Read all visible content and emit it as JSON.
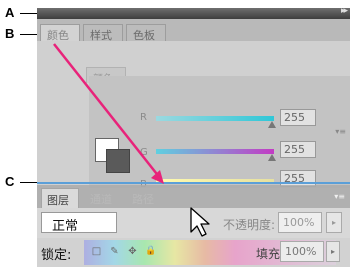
{
  "callouts": {
    "a": "A",
    "b": "B",
    "c": "C"
  },
  "panel": {
    "expand_glyph": "▸▸",
    "tabs": [
      "颜色",
      "样式",
      "色板"
    ],
    "ghost_tab": "颜色",
    "menu_glyph": "▾≡",
    "sliders": [
      {
        "label": "R",
        "value": "255"
      },
      {
        "label": "G",
        "value": "255"
      },
      {
        "label": "B",
        "value": "255"
      }
    ]
  },
  "layers": {
    "tabs": [
      "图层",
      "通道",
      "路径"
    ],
    "menu_glyph": "▾≡",
    "blend_mode": "正常",
    "opacity_label": "不透明度:",
    "opacity_value": "100%",
    "stepper_glyph": "▸",
    "lock_label": "锁定:",
    "fill_label": "填充:",
    "fill_value": "100%"
  },
  "icons": {
    "lock_transparent": "□",
    "lock_paint": "✎",
    "lock_move": "✥",
    "lock_all": "🔒"
  },
  "colors": {
    "drag_arrow": "#e8237a",
    "drop_indicator": "#5b9fd8"
  }
}
